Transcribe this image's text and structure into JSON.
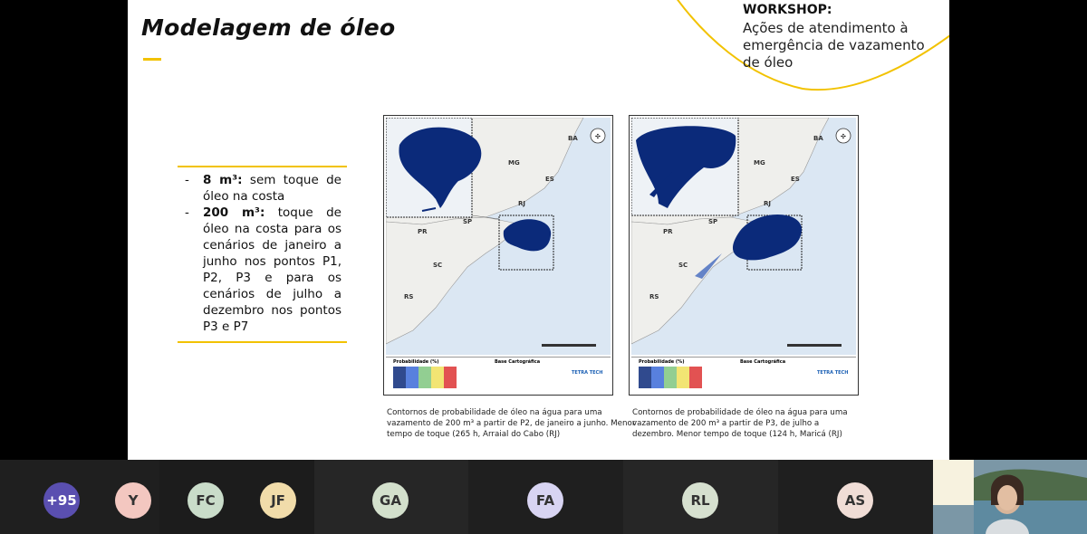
{
  "slide": {
    "title": "Modelagem de óleo",
    "workshop_head": "WORKSHOP:",
    "workshop_body": "Ações de atendimento à emergência de vazamento de óleo",
    "bullets": [
      {
        "bold": "8 m³:",
        "text": " sem toque de óleo na costa"
      },
      {
        "bold": "200 m³:",
        "text": " toque de óleo na costa para os cenários de janeiro a junho nos pontos P1, P2, P3 e para os cenários de julho a dezembro nos pontos P3 e P7"
      }
    ],
    "maps": [
      {
        "legend_title": "Probabilidade (%)",
        "base_title": "Base Cartográfica",
        "brand": "TETRA TECH",
        "caption": "Contornos de probabilidade de óleo na água para uma vazamento de 200 m³ a partir de P2, de janeiro a junho. Menor tempo de toque (265 h, Arraial do Cabo (RJ)"
      },
      {
        "legend_title": "Probabilidade (%)",
        "base_title": "Base Cartográfica",
        "brand": "TETRA TECH",
        "caption": "Contornos de probabilidade de óleo na água para uma vazamento de 200 m³ a partir de P3, de julho a dezembro. Menor tempo de toque (124 h, Maricá (RJ)"
      }
    ],
    "map_labels": [
      "BA",
      "MG",
      "ES",
      "RJ",
      "SP",
      "PR",
      "SC",
      "RS"
    ]
  },
  "participants": [
    {
      "initials": "+95",
      "color": "#5a4fb0",
      "text_color": "#ffffff"
    },
    {
      "initials": "Y",
      "color": "#f3c7c0",
      "text_color": "#333333"
    },
    {
      "initials": "FC",
      "color": "#c9dcc9",
      "text_color": "#333333"
    },
    {
      "initials": "JF",
      "color": "#f1dcaa",
      "text_color": "#333333"
    },
    {
      "initials": "GA",
      "color": "#d3e0cc",
      "text_color": "#333333"
    },
    {
      "initials": "FA",
      "color": "#d8d4f2",
      "text_color": "#333333"
    },
    {
      "initials": "RL",
      "color": "#d6e0cf",
      "text_color": "#333333"
    },
    {
      "initials": "AS",
      "color": "#f0ddd6",
      "text_color": "#333333"
    }
  ],
  "colors": {
    "accent": "#f2c200",
    "oil": "#0b2a7a",
    "land": "#efefec",
    "sea": "#dbe7f3"
  }
}
